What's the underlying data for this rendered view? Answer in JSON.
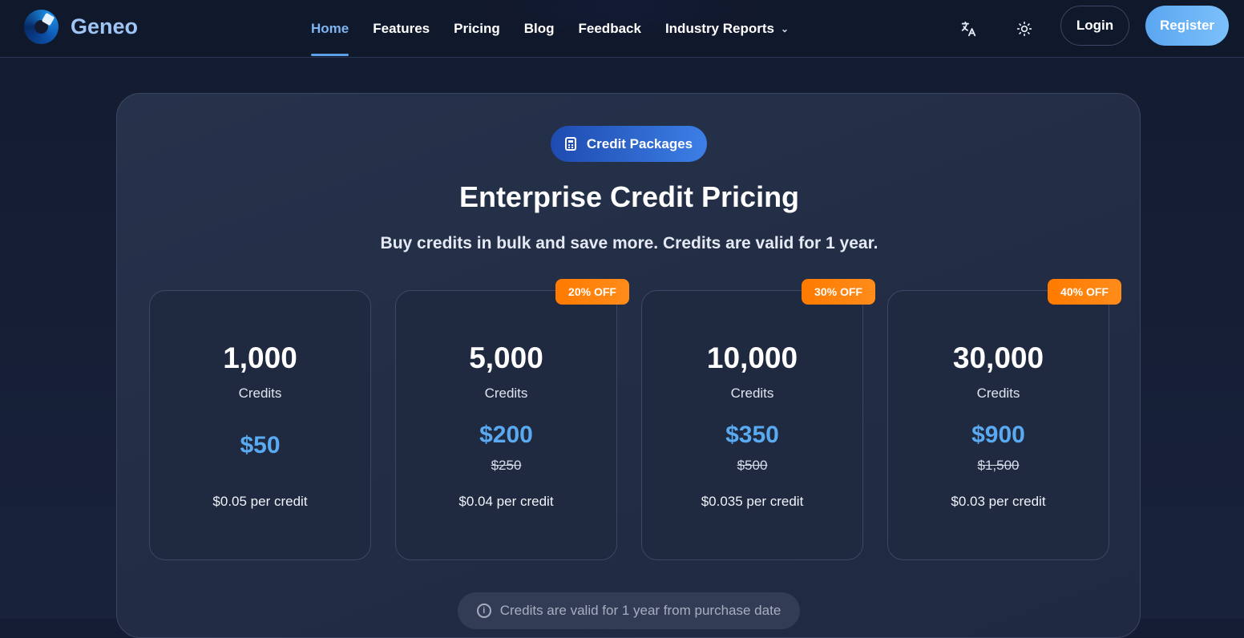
{
  "brand": {
    "name": "Geneo",
    "logo_icon": "geneo-logo-icon"
  },
  "nav": {
    "links": [
      {
        "label": "Home",
        "active": true
      },
      {
        "label": "Features"
      },
      {
        "label": "Pricing"
      },
      {
        "label": "Blog"
      },
      {
        "label": "Feedback"
      },
      {
        "label": "Industry Reports",
        "dropdown": true
      }
    ],
    "translate_icon": "translate-icon",
    "theme_icon": "sun-icon",
    "login_label": "Login",
    "register_label": "Register"
  },
  "pricing": {
    "pill_label": "Credit Packages",
    "pill_icon": "calculator-icon",
    "title": "Enterprise Credit Pricing",
    "subtitle": "Buy credits in bulk and save more. Credits are valid for 1 year.",
    "credits_label": "Credits",
    "packages": [
      {
        "credits": "1,000",
        "price": "$50",
        "old_price": "",
        "per_credit": "$0.05 per credit",
        "badge": ""
      },
      {
        "credits": "5,000",
        "price": "$200",
        "old_price": "$250",
        "per_credit": "$0.04 per credit",
        "badge": "20% OFF"
      },
      {
        "credits": "10,000",
        "price": "$350",
        "old_price": "$500",
        "per_credit": "$0.035 per credit",
        "badge": "30% OFF"
      },
      {
        "credits": "30,000",
        "price": "$900",
        "old_price": "$1,500",
        "per_credit": "$0.03 per credit",
        "badge": "40% OFF"
      }
    ],
    "note": "Credits are valid for 1 year from purchase date",
    "note_icon": "info-icon"
  },
  "colors": {
    "accent": "#5aaaf2",
    "badge": "#ff7a00",
    "background": "#141d33"
  }
}
